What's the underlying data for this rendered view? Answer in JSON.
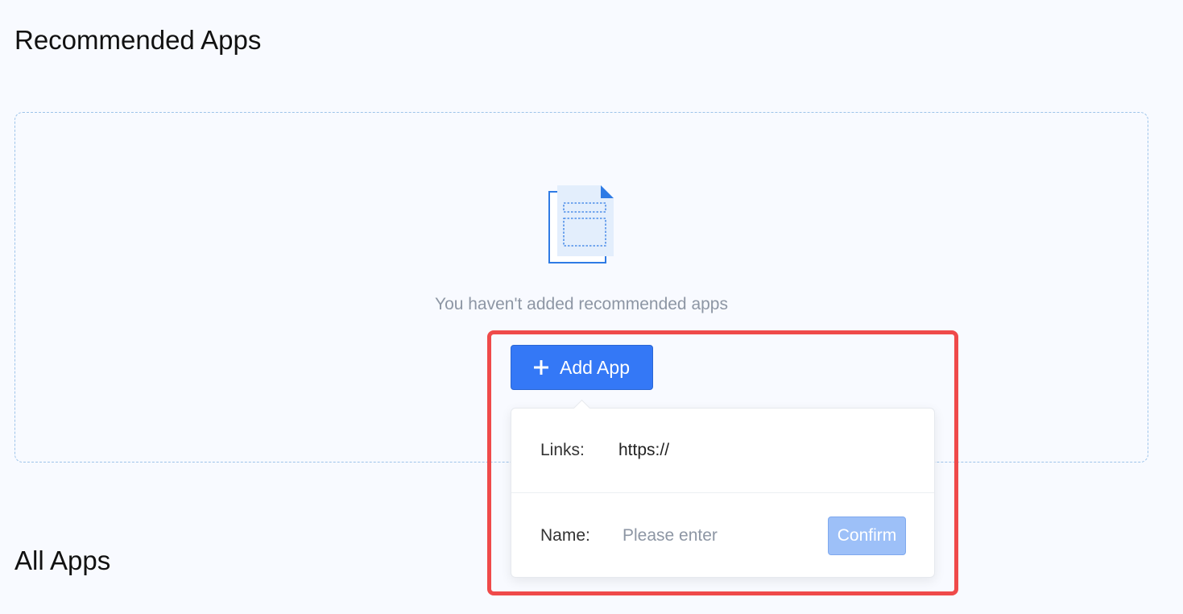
{
  "recommended": {
    "title": "Recommended Apps",
    "empty_icon": "empty-document-icon",
    "empty_text": "You haven't added recommended apps",
    "add_button": {
      "icon": "plus-icon",
      "label": "Add App"
    }
  },
  "popover": {
    "links_label": "Links:",
    "links_value": "https://",
    "name_label": "Name:",
    "name_placeholder": "Please enter",
    "name_value": "",
    "confirm_label": "Confirm",
    "confirm_disabled": true
  },
  "all_apps": {
    "title": "All Apps"
  },
  "colors": {
    "primary": "#3478f6",
    "primary_disabled": "#9dc0f8",
    "highlight": "#ef4a4a",
    "muted_text": "#8d96a4",
    "background": "#f8faff"
  }
}
